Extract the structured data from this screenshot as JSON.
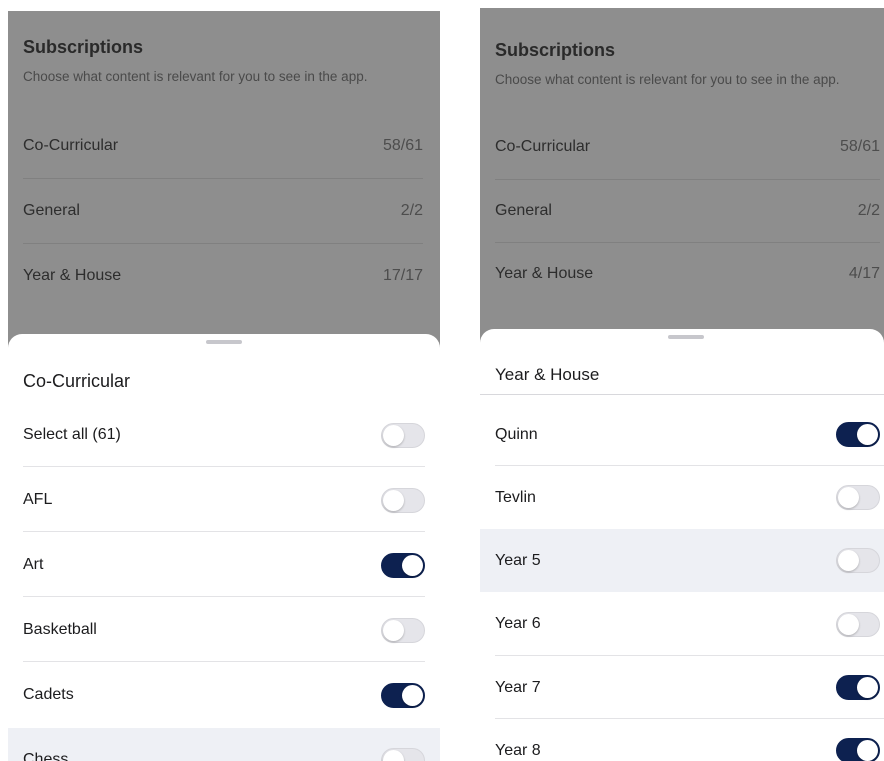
{
  "colors": {
    "toggle_on": "#0d2150",
    "toggle_off": "#e5e5ea",
    "backdrop": "#8e8e8e"
  },
  "left": {
    "subscriptions": {
      "title": "Subscriptions",
      "description": "Choose what content is relevant for you to see in the app.",
      "rows": [
        {
          "label": "Co-Curricular",
          "count": "58/61"
        },
        {
          "label": "General",
          "count": "2/2"
        },
        {
          "label": "Year & House",
          "count": "17/17"
        }
      ]
    },
    "sheet": {
      "title": "Co-Curricular",
      "items": [
        {
          "label": "Select all (61)",
          "on": false
        },
        {
          "label": "AFL",
          "on": false
        },
        {
          "label": "Art",
          "on": true
        },
        {
          "label": "Basketball",
          "on": false
        },
        {
          "label": "Cadets",
          "on": true
        },
        {
          "label": "Chess",
          "on": false
        }
      ]
    }
  },
  "right": {
    "subscriptions": {
      "title": "Subscriptions",
      "description": "Choose what content is relevant for you to see in the app.",
      "rows": [
        {
          "label": "Co-Curricular",
          "count": "58/61"
        },
        {
          "label": "General",
          "count": "2/2"
        },
        {
          "label": "Year & House",
          "count": "4/17"
        }
      ]
    },
    "sheet": {
      "title": "Year & House",
      "items": [
        {
          "label": "Quinn",
          "on": true
        },
        {
          "label": "Tevlin",
          "on": false
        },
        {
          "label": "Year 5",
          "on": false
        },
        {
          "label": "Year 6",
          "on": false
        },
        {
          "label": "Year 7",
          "on": true
        },
        {
          "label": "Year 8",
          "on": true
        }
      ]
    }
  }
}
